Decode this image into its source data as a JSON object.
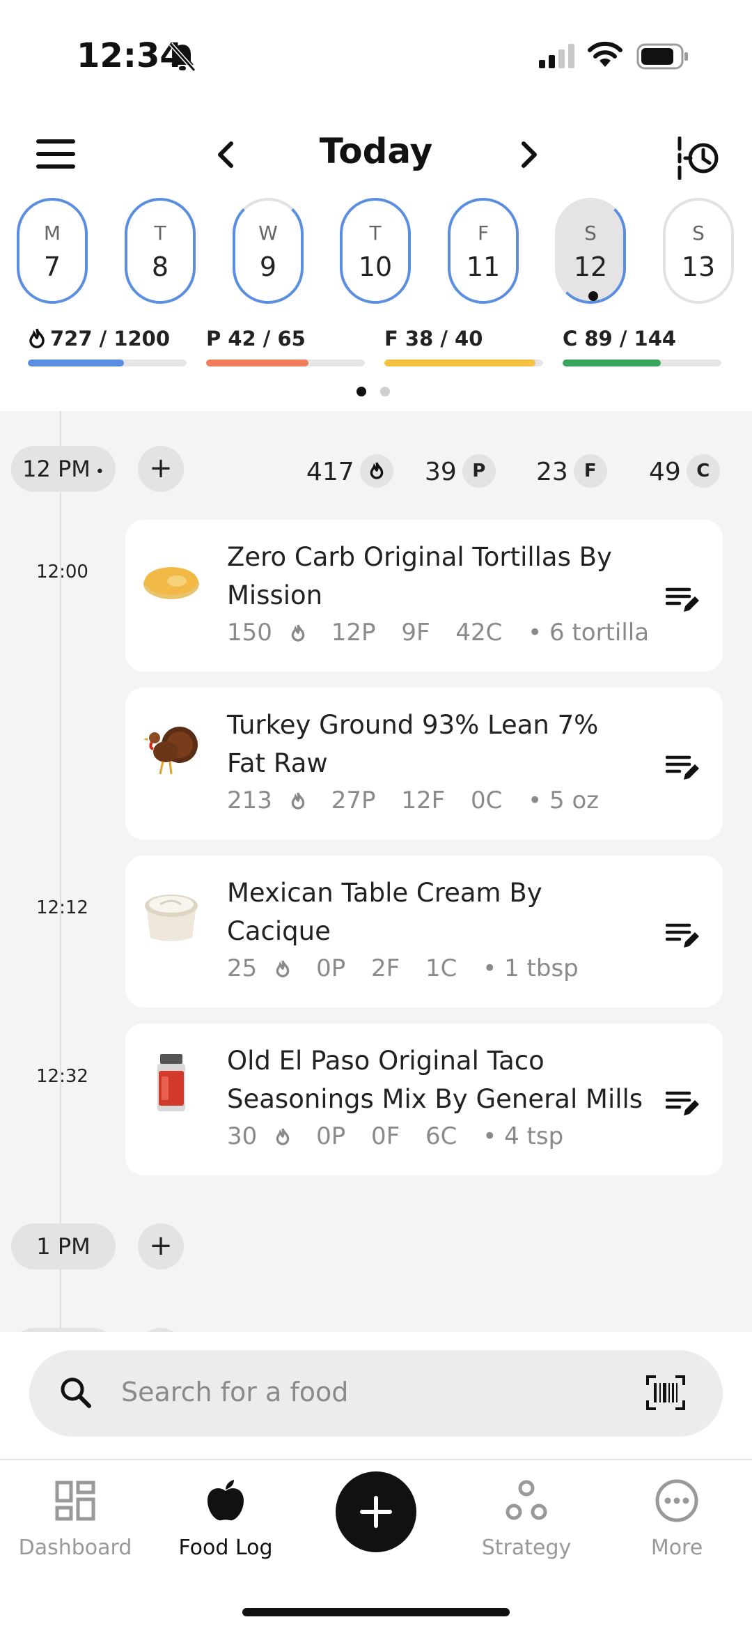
{
  "status_bar": {
    "time": "12:34"
  },
  "header": {
    "title": "Today"
  },
  "week": [
    {
      "letter": "M",
      "num": "7",
      "state": "past"
    },
    {
      "letter": "T",
      "num": "8",
      "state": "past"
    },
    {
      "letter": "W",
      "num": "9",
      "state": "past"
    },
    {
      "letter": "T",
      "num": "10",
      "state": "past"
    },
    {
      "letter": "F",
      "num": "11",
      "state": "past"
    },
    {
      "letter": "S",
      "num": "12",
      "state": "selected"
    },
    {
      "letter": "S",
      "num": "13",
      "state": "future"
    }
  ],
  "macros": [
    {
      "key": "calories",
      "label": "727 / 1200",
      "value": 727,
      "target": 1200,
      "color": "#5b8ee0"
    },
    {
      "key": "protein",
      "label": "P 42 / 65",
      "value": 42,
      "target": 65,
      "color": "#f07d5c"
    },
    {
      "key": "fat",
      "label": "F 38 / 40",
      "value": 38,
      "target": 40,
      "color": "#f4c141"
    },
    {
      "key": "carbs",
      "label": "C 89 / 144",
      "value": 89,
      "target": 144,
      "color": "#3aa55d"
    }
  ],
  "log": {
    "hour_12": {
      "label": "12 PM",
      "calories": "417",
      "protein": "39",
      "fat": "23",
      "carbs": "49",
      "badge_p": "P",
      "badge_f": "F",
      "badge_c": "C"
    },
    "hour_1": {
      "label": "1 PM"
    },
    "entries": [
      {
        "time": "12:00",
        "name": "Zero Carb Original Tortillas By Mission",
        "calories": "150",
        "protein": "12P",
        "fat": "9F",
        "carbs": "42C",
        "serving": "• 6 tortilla",
        "icon": "tortilla-icon"
      },
      {
        "time": "",
        "name": "Turkey Ground 93% Lean 7% Fat Raw",
        "calories": "213",
        "protein": "27P",
        "fat": "12F",
        "carbs": "0C",
        "serving": "• 5 oz",
        "icon": "turkey-icon"
      },
      {
        "time": "12:12",
        "name": "Mexican Table Cream By Cacique",
        "calories": "25",
        "protein": "0P",
        "fat": "2F",
        "carbs": "1C",
        "serving": "• 1 tbsp",
        "icon": "cream-cup-icon"
      },
      {
        "time": "12:32",
        "name": "Old El Paso Original Taco Seasonings Mix By General Mills",
        "calories": "30",
        "protein": "0P",
        "fat": "0F",
        "carbs": "6C",
        "serving": "• 4 tsp",
        "icon": "spice-jar-icon"
      }
    ]
  },
  "search": {
    "placeholder": "Search for a food"
  },
  "tabs": {
    "dashboard": "Dashboard",
    "food_log": "Food Log",
    "strategy": "Strategy",
    "more": "More"
  }
}
